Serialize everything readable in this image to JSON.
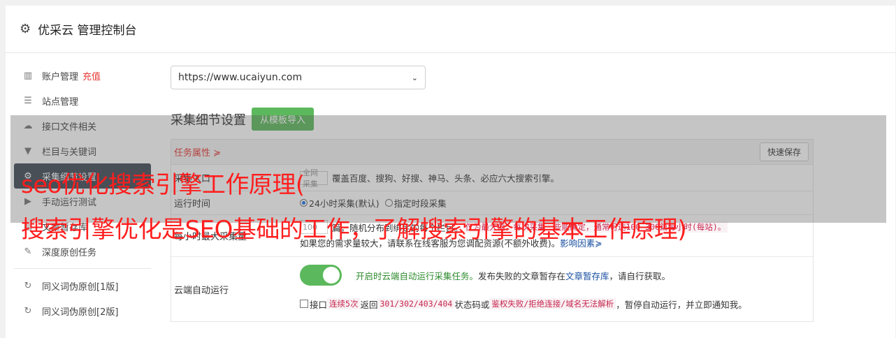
{
  "header": {
    "title": "优采云 管理控制台",
    "icon": "gear-icon"
  },
  "sidebar": {
    "items": [
      {
        "label": "账户管理",
        "badge": "充值",
        "icon": "bar-chart-icon",
        "glyph": "▥"
      },
      {
        "label": "站点管理",
        "icon": "server-icon",
        "glyph": "☰"
      },
      {
        "label": "接口文件相关",
        "icon": "cloud-upload-icon",
        "glyph": "☁"
      },
      {
        "label": "栏目与关键词",
        "icon": "filter-icon",
        "glyph": "▼"
      },
      {
        "label": "采集细节设置",
        "icon": "cogs-icon",
        "glyph": "⚙"
      },
      {
        "label": "手动运行测试",
        "icon": "play-circle-icon",
        "glyph": "▶"
      },
      {
        "label": "文章暂存库",
        "icon": "archive-icon",
        "glyph": "▤"
      },
      {
        "label": "深度原创任务",
        "icon": "edit-icon",
        "glyph": "✎"
      },
      {
        "label": "同义词伪原创[1版]",
        "icon": "refresh-icon",
        "glyph": "↻"
      },
      {
        "label": "同义词伪原创[2版]",
        "icon": "refresh-icon",
        "glyph": "↻"
      }
    ],
    "active_index": 4
  },
  "site_select": {
    "value": "https://www.ucaiyun.com"
  },
  "collect": {
    "title": "采集细节设置",
    "import_button": "从模板导入",
    "tab_label": "任务属性 ≽",
    "quick_save": "快速保存",
    "entry_label": "采集入口",
    "entry_input": "全网采集",
    "entry_desc": "覆盖百度、搜狗、好搜、神马、头条、必应六大搜索引擎。",
    "time_label": "运行时间",
    "time_option_1": "24小时采集(默认)",
    "time_option_2": "指定时段采集",
    "max_label": "每小时最大采集量",
    "max_input": "100",
    "max_desc_1": "篇，随机分布到绑定的每个栏目。",
    "max_desc_2": "仅为最大值，每次采集一些能确定，通常可达100-300篇每小时(每站)。",
    "max_desc_3": "如果您的需求量较大，请联系在线客服为您调配资源(不额外收费)。",
    "max_link": "影响因素≽",
    "cloud_label": "云端自动运行",
    "cloud_desc_green": "开启时云端自动运行采集任务。",
    "cloud_desc_1": "发布失败的文章暂存在",
    "cloud_link": "文章暂存库",
    "cloud_desc_2": "，请自行获取。",
    "cloud2_a": "接口",
    "cloud2_tag1": "连续5次",
    "cloud2_b": "返回",
    "cloud2_tag2": "301/302/403/404",
    "cloud2_c": "状态码或",
    "cloud2_tag3": "鉴权失败/拒绝连接/域名无法解析",
    "cloud2_d": "，暂停自动运行，并立即通知我。"
  },
  "overlay": {
    "line1": "seo优化搜索引擎工作原理(",
    "line2": "搜索引擎优化是SEO基础的工作，了解搜索引擎的基本工作原理)"
  },
  "colors": {
    "accent_green": "#5cb85c",
    "active_nav": "#3f4a56",
    "overlay_text": "#ff1e1e"
  }
}
